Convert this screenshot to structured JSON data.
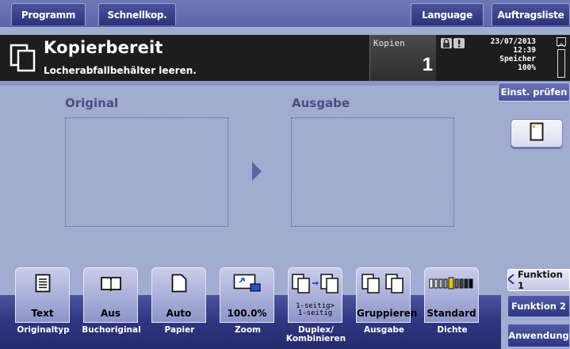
{
  "topbar": {
    "program": "Programm",
    "quick_copy": "Schnellkop.",
    "language": "Language",
    "job_list": "Auftragsliste"
  },
  "status": {
    "title": "Kopierbereit",
    "message": "Locherabfallbehälter leeren.",
    "copies_label": "Kopien",
    "copies_value": "1",
    "date": "23/07/2013",
    "time": "12:39",
    "memory_label": "Speicher",
    "memory_value": "100%"
  },
  "check_settings": "Einst. prüfen",
  "main": {
    "original_label": "Original",
    "output_label": "Ausgabe"
  },
  "functions": [
    {
      "value": "Text",
      "caption": "Originaltyp",
      "icon": "document-lines-icon"
    },
    {
      "value": "Aus",
      "caption": "Buchoriginal",
      "icon": "open-book-icon"
    },
    {
      "value": "Auto",
      "caption": "Papier",
      "icon": "paper-sheet-icon"
    },
    {
      "value": "100.0%",
      "caption": "Zoom",
      "icon": "zoom-icon"
    },
    {
      "value_line1": "1-seitig>",
      "value_line2": "1-seitig",
      "caption_line1": "Duplex/",
      "caption_line2": "Kombinieren",
      "icon": "duplex-icon"
    },
    {
      "value": "Gruppieren",
      "caption": "Ausgabe",
      "icon": "group-output-icon"
    },
    {
      "value": "Standard",
      "caption": "Dichte",
      "icon": "density-scale-icon"
    }
  ],
  "side_tabs": {
    "function1": "Funktion 1",
    "function2": "Funktion 2",
    "application": "Anwendung"
  },
  "colors": {
    "background": "#a2abd0",
    "tab_blue": "#2d3378",
    "header_black": "#1d1d1d",
    "label_text": "#4a4f7e"
  }
}
